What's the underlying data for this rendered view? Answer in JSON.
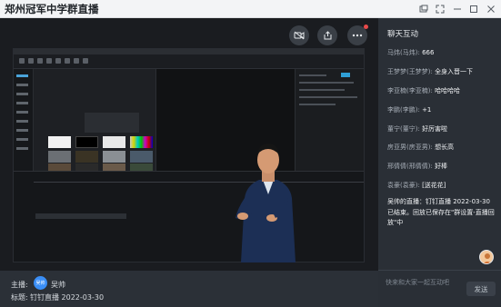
{
  "window": {
    "title": "郑州冠军中学群直播"
  },
  "video": {
    "presenter_caption": ""
  },
  "info": {
    "host_label": "主播:",
    "host_avatar_text": "吴帅",
    "host_name": "吴帅",
    "subject_label": "标题:",
    "subject": "钉钉直播 2022-03-30"
  },
  "chat": {
    "title": "聊天互动",
    "messages": [
      {
        "name": "马炜(马炜):",
        "text": "666"
      },
      {
        "name": "王梦梦(王梦梦):",
        "text": "全身入晋一下"
      },
      {
        "name": "李亚楠(李亚楠):",
        "text": "哈哈哈哈"
      },
      {
        "name": "李鹏(李鹏):",
        "text": "+1"
      },
      {
        "name": "董宁(董宁):",
        "text": "好厉害啦"
      },
      {
        "name": "房亚男(房亚男):",
        "text": "想长高"
      },
      {
        "name": "邢倩倩(邢倩倩):",
        "text": "好棒"
      },
      {
        "name": "袁豪(袁豪):",
        "text": "[送花花]"
      }
    ],
    "system_message": "吴帅的直播：钉钉直播 2022-03-30 已结束。回放已保存在\"群设置-直播回放\"中",
    "input_placeholder": "快来和大家一起互动吧",
    "send_label": "发送"
  }
}
